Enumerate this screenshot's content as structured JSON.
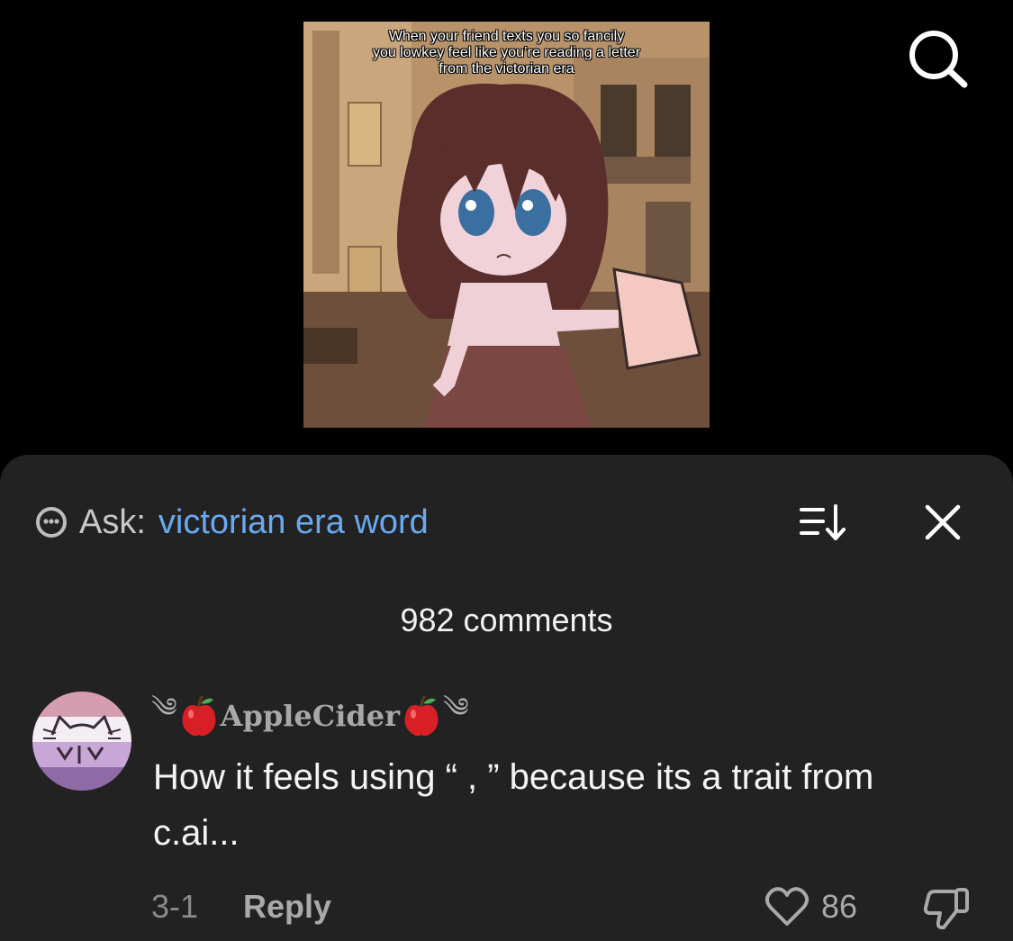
{
  "video": {
    "caption_lines": [
      "When your friend texts you so fancily",
      "you lowkey feel like you’re reading a letter",
      "from the victorian era"
    ]
  },
  "header": {
    "search_icon": "search-icon"
  },
  "comments_panel": {
    "ask_label": "Ask:",
    "ask_query": "victorian era word",
    "ask_icon": "ai-chat-icon",
    "sort_icon": "sort-icon",
    "close_icon": "close-icon",
    "comment_count": "982 comments",
    "query_color": "#6aa9ee"
  },
  "comment": {
    "username": "AppleCider",
    "username_prefix": "༄",
    "username_suffix": "༄",
    "text": "How it feels using “ , ” because its a trait from c.ai...",
    "date": "3-1",
    "reply_label": "Reply",
    "like_count": "86",
    "like_icon": "heart-icon",
    "dislike_icon": "thumbs-down-icon",
    "avatar_colors": [
      "#d9a0b3",
      "#f3eef3",
      "#c9a9d8",
      "#8f6aa8"
    ]
  }
}
